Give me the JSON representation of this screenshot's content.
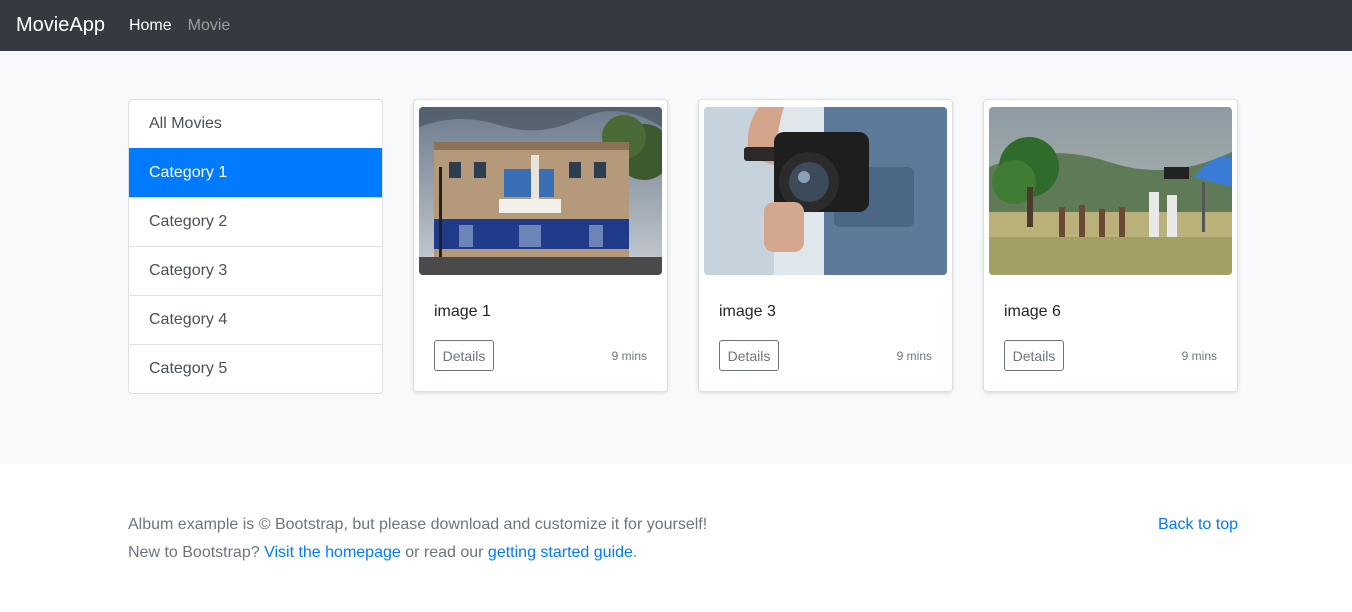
{
  "navbar": {
    "brand": "MovieApp",
    "links": [
      {
        "label": "Home",
        "active": true
      },
      {
        "label": "Movie",
        "active": false
      }
    ]
  },
  "sidebar": {
    "items": [
      {
        "label": "All Movies"
      },
      {
        "label": "Category 1",
        "active": true
      },
      {
        "label": "Category 2"
      },
      {
        "label": "Category 3"
      },
      {
        "label": "Category 4"
      },
      {
        "label": "Category 5"
      }
    ]
  },
  "cards": [
    {
      "title": "image 1",
      "button": "Details",
      "duration": "9 mins"
    },
    {
      "title": "image 3",
      "button": "Details",
      "duration": "9 mins"
    },
    {
      "title": "image 6",
      "button": "Details",
      "duration": "9 mins"
    }
  ],
  "footer": {
    "line1": "Album example is © Bootstrap, but please download and customize it for yourself!",
    "line2_prefix": "New to Bootstrap? ",
    "homepage_link": "Visit the homepage",
    "line2_middle": " or read our ",
    "guide_link": "getting started guide",
    "line2_suffix": ".",
    "back_to_top": "Back to top"
  },
  "colors": {
    "navbar_bg": "#343a40",
    "accent": "#007bff",
    "page_bg": "#f8f9fa",
    "muted_text": "#6c757d"
  }
}
